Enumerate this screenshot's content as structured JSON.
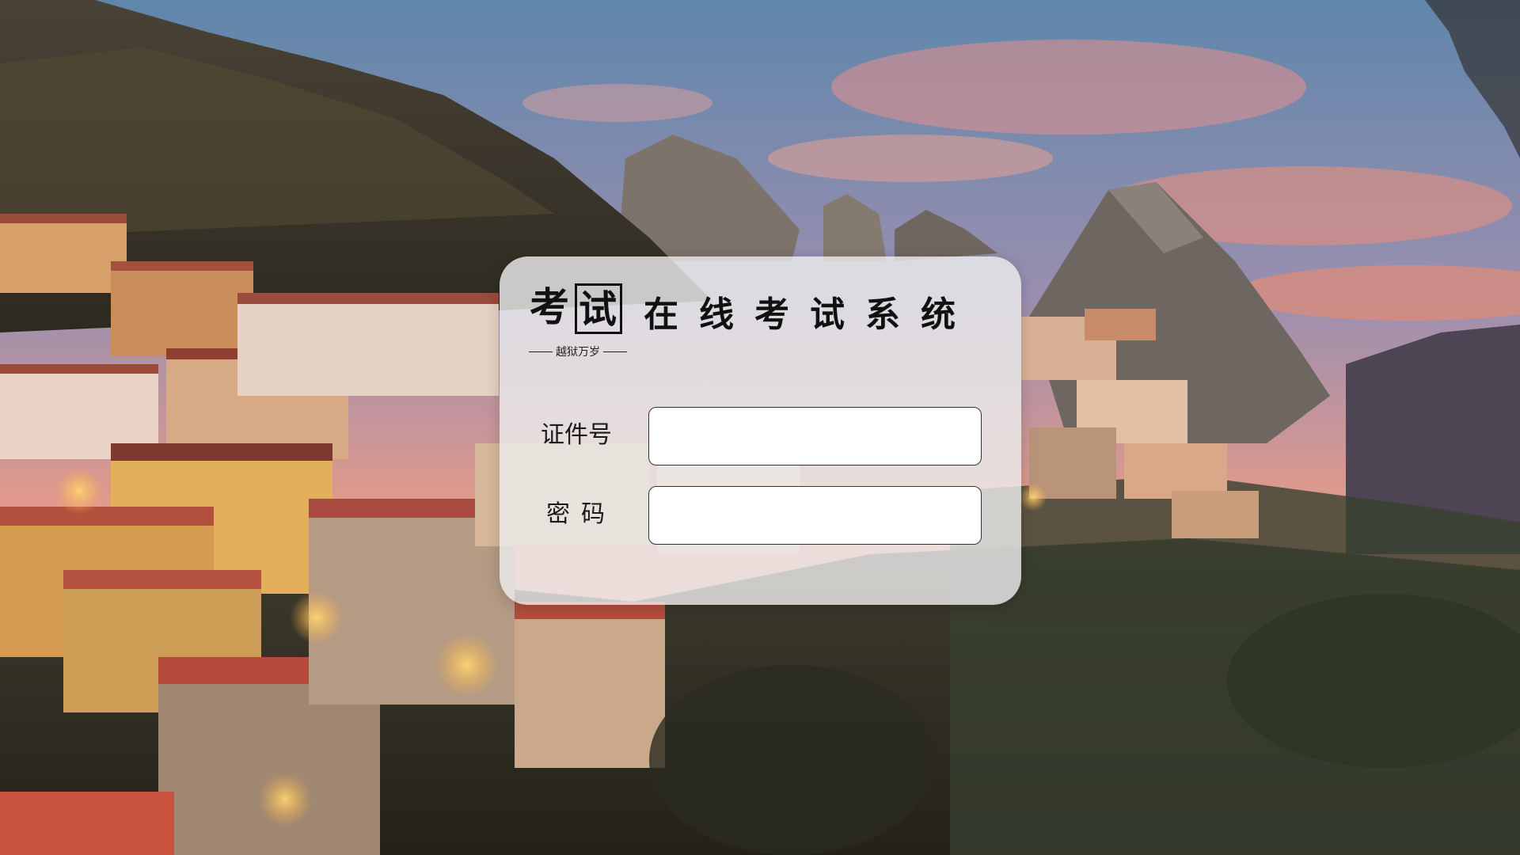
{
  "logo": {
    "char_1": "考",
    "char_2": "试",
    "slogan": "越狱万岁"
  },
  "app_title": "在线考试系统",
  "form": {
    "id_label": "证件号",
    "id_value": "",
    "password_label": "密码",
    "password_value": ""
  },
  "colors": {
    "card_background": "#ececec",
    "text": "#111111",
    "input_background": "#ffffff"
  }
}
